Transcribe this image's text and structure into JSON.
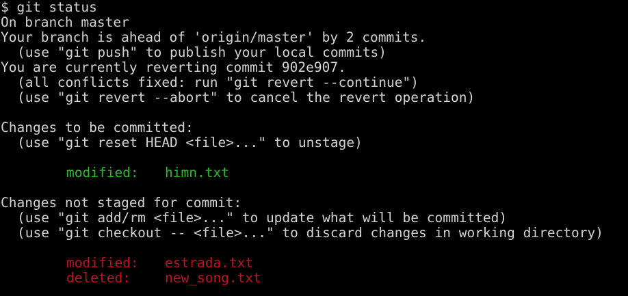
{
  "colors": {
    "background": "#000000",
    "text": "#d3d3d3",
    "staged": "#25bc24",
    "unstaged": "#c50f1f"
  },
  "terminal": {
    "command": "$ git status",
    "branch_line": "On branch master",
    "ahead_line": "Your branch is ahead of 'origin/master' by 2 commits.",
    "push_hint": "(use \"git push\" to publish your local commits)",
    "revert_line": "You are currently reverting commit 902e907.",
    "continue_hint": "(all conflicts fixed: run \"git revert --continue\")",
    "abort_hint": "(use \"git revert --abort\" to cancel the revert operation)",
    "staged_header": "Changes to be committed:",
    "unstage_hint": "(use \"git reset HEAD <file>...\" to unstage)",
    "staged_files": [
      {
        "status": "modified:",
        "file": "himn.txt"
      }
    ],
    "unstaged_header": "Changes not staged for commit:",
    "add_hint": "(use \"git add/rm <file>...\" to update what will be committed)",
    "checkout_hint": "(use \"git checkout -- <file>...\" to discard changes in working directory)",
    "unstaged_files": [
      {
        "status": "modified:",
        "file": "estrada.txt"
      },
      {
        "status": "deleted:",
        "file": "new_song.txt"
      }
    ]
  }
}
